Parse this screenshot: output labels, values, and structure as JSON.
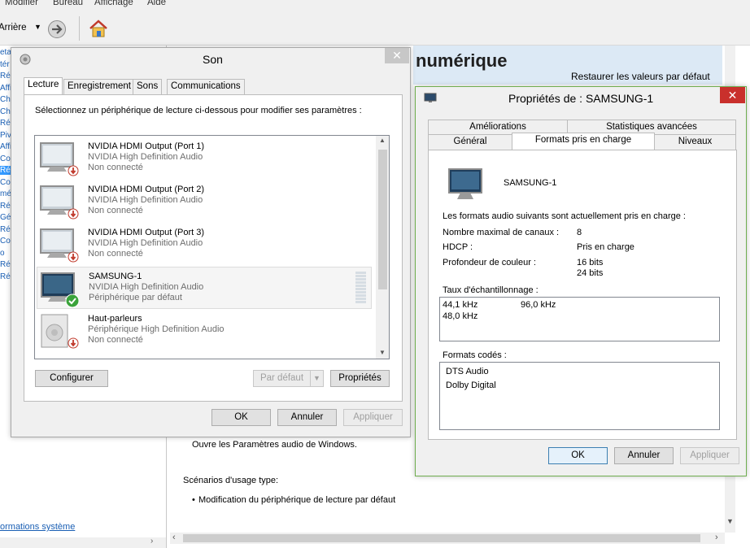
{
  "background": {
    "menu": [
      "Modifier",
      "Bureau",
      "Affichage",
      "Aide"
    ],
    "back_label": "Arrière",
    "header_title": "numérique",
    "restore_link": "Restaurer les valeurs par défaut",
    "left_fragments": [
      "eta",
      "tér",
      "Rég",
      "Affi",
      "Cha",
      "Cha",
      "Rég",
      "Pivo",
      "Affi",
      "Con",
      "Rég",
      "Con",
      "mé",
      "Rég",
      "Gér",
      "Rég",
      "Con",
      "o",
      "Rég",
      "Rég"
    ],
    "body_text": "Ouvre les Paramètres audio de Windows.",
    "scenarios_title": "Scénarios d'usage type:",
    "scenario_item": "Modification du périphérique de lecture par défaut",
    "sysinfo_link": "ormations système"
  },
  "son": {
    "title": "Son",
    "tabs": [
      "Lecture",
      "Enregistrement",
      "Sons",
      "Communications"
    ],
    "instruction": "Sélectionnez un périphérique de lecture ci-dessous pour modifier ses paramètres :",
    "devices": [
      {
        "name": "NVIDIA HDMI Output (Port 1)",
        "driver": "NVIDIA High Definition Audio",
        "status": "Non connecté"
      },
      {
        "name": "NVIDIA HDMI Output (Port 2)",
        "driver": "NVIDIA High Definition Audio",
        "status": "Non connecté"
      },
      {
        "name": "NVIDIA HDMI Output (Port 3)",
        "driver": "NVIDIA High Definition Audio",
        "status": "Non connecté"
      },
      {
        "name": "SAMSUNG-1",
        "driver": "NVIDIA High Definition Audio",
        "status": "Périphérique par défaut"
      },
      {
        "name": "Haut-parleurs",
        "driver": "Périphérique High Definition Audio",
        "status": "Non connecté"
      }
    ],
    "configure": "Configurer",
    "default": "Par défaut",
    "properties": "Propriétés",
    "ok": "OK",
    "cancel": "Annuler",
    "apply": "Appliquer"
  },
  "prop": {
    "title": "Propriétés de : SAMSUNG-1",
    "tabs_row1": [
      "Améliorations",
      "Statistiques avancées"
    ],
    "tabs_row2": [
      "Général",
      "Formats pris en charge",
      "Niveaux"
    ],
    "device_name": "SAMSUNG-1",
    "intro": "Les formats audio suivants sont actuellement pris en charge :",
    "channels_label": "Nombre maximal de canaux :",
    "channels_value": "8",
    "hdcp_label": "HDCP :",
    "hdcp_value": "Pris en charge",
    "depth_label": "Profondeur de couleur :",
    "depth_values": [
      "16 bits",
      "24 bits"
    ],
    "rates_label": "Taux d'échantillonnage :",
    "rates": [
      "44,1 kHz",
      "96,0 kHz",
      "48,0 kHz"
    ],
    "codecs_label": "Formats codés :",
    "codecs": [
      "DTS Audio",
      "Dolby Digital"
    ],
    "ok": "OK",
    "cancel": "Annuler",
    "apply": "Appliquer"
  }
}
